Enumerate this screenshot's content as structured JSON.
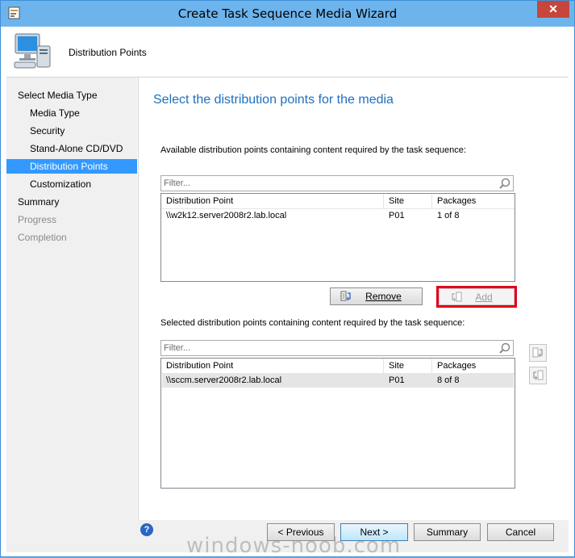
{
  "window": {
    "title": "Create Task Sequence Media Wizard",
    "close_label": "✕"
  },
  "header": {
    "title": "Distribution Points",
    "icon": "computer-wizard-icon"
  },
  "nav": {
    "items": [
      {
        "label": "Select Media Type",
        "state": "normal"
      },
      {
        "label": "Media Type",
        "state": "normal"
      },
      {
        "label": "Security",
        "state": "normal"
      },
      {
        "label": "Stand-Alone CD/DVD",
        "state": "normal"
      },
      {
        "label": "Distribution Points",
        "state": "selected"
      },
      {
        "label": "Customization",
        "state": "normal"
      },
      {
        "label": "Summary",
        "state": "normal"
      },
      {
        "label": "Progress",
        "state": "disabled"
      },
      {
        "label": "Completion",
        "state": "disabled"
      }
    ]
  },
  "main": {
    "title": "Select the distribution points for the media",
    "available": {
      "label": "Available distribution points containing content required by the task sequence:",
      "filter_placeholder": "Filter...",
      "columns": [
        "Distribution Point",
        "Site",
        "Packages"
      ],
      "rows": [
        [
          "\\\\w2k12.server2008r2.lab.local",
          "P01",
          "1 of 8"
        ]
      ]
    },
    "remove_label": "Remove",
    "add_label": "Add",
    "selected": {
      "label": "Selected distribution points containing content required by the task sequence:",
      "filter_placeholder": "Filter...",
      "columns": [
        "Distribution Point",
        "Site",
        "Packages"
      ],
      "rows": [
        [
          "\\\\sccm.server2008r2.lab.local",
          "P01",
          "8 of 8"
        ]
      ]
    }
  },
  "footer": {
    "previous_label": "< Previous",
    "next_label": "Next >",
    "summary_label": "Summary",
    "cancel_label": "Cancel",
    "help_label": "?"
  },
  "watermark": "windows-noob.com",
  "colors": {
    "accent": "#3399ff",
    "title_blue": "#1e6fbf",
    "highlight_red": "#e2001a",
    "titlebar": "#6db4ec"
  }
}
